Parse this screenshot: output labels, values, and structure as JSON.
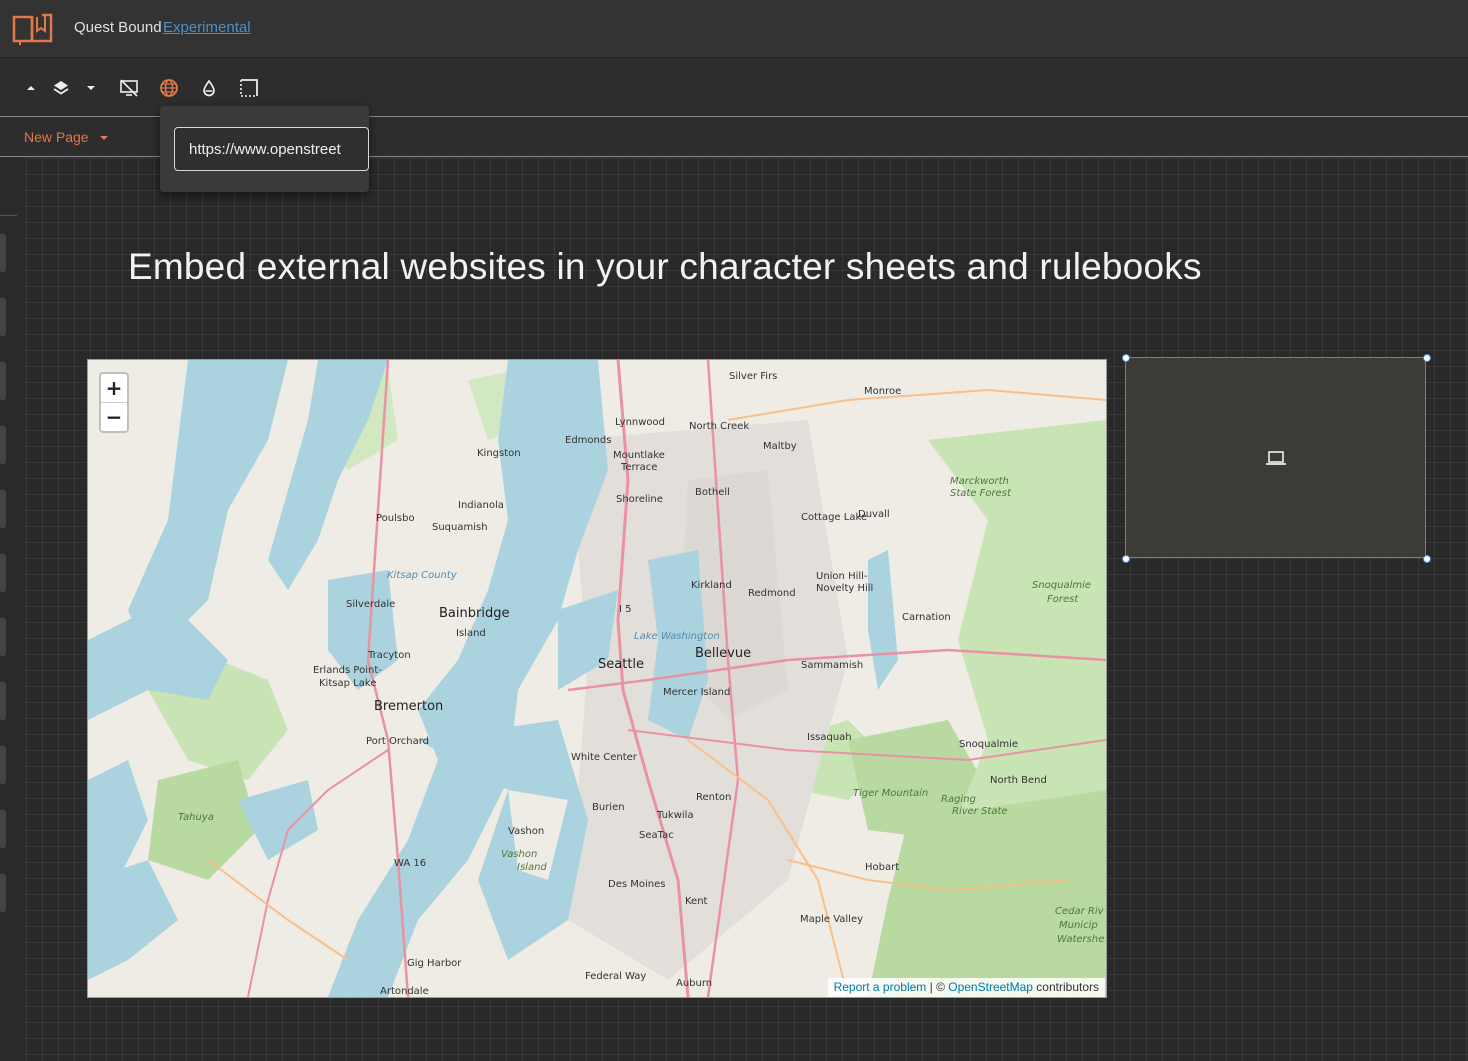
{
  "app": {
    "title": "Quest Bound",
    "tag": "Experimental",
    "brand_color": "#e0784a"
  },
  "toolbar": {
    "buttons": [
      {
        "icon": "caret-up-icon"
      },
      {
        "icon": "layers-icon"
      },
      {
        "icon": "caret-down-icon"
      },
      {
        "icon": "screen-off-icon"
      },
      {
        "icon": "globe-icon",
        "active": true
      },
      {
        "icon": "droplet-icon"
      },
      {
        "icon": "dashed-border-icon"
      }
    ]
  },
  "pages": {
    "current": "New Page"
  },
  "popover": {
    "url_value": "https://www.openstreet"
  },
  "canvas": {
    "headline": "Embed external websites in your character sheets and rulebooks"
  },
  "map": {
    "zoom_in": "+",
    "zoom_out": "−",
    "attribution": {
      "report": "Report a problem",
      "separator": " | © ",
      "osm": "OpenStreetMap",
      "contributors": " contributors"
    },
    "labels": [
      {
        "text": "Silver Firs"
      },
      {
        "text": "Monroe"
      },
      {
        "text": "Lynnwood"
      },
      {
        "text": "North Creek"
      },
      {
        "text": "Edmonds"
      },
      {
        "text": "Maltby"
      },
      {
        "text": "Kingston"
      },
      {
        "text": "Mountlake"
      },
      {
        "text": "Terrace"
      },
      {
        "text": "Marckworth"
      },
      {
        "text": "State Forest"
      },
      {
        "text": "Bothell"
      },
      {
        "text": "Shoreline"
      },
      {
        "text": "Indianola"
      },
      {
        "text": "Poulsbo"
      },
      {
        "text": "Cottage Lake"
      },
      {
        "text": "Duvall"
      },
      {
        "text": "Suquamish"
      },
      {
        "text": "Kitsap County"
      },
      {
        "text": "Union Hill-"
      },
      {
        "text": "Novelty Hill"
      },
      {
        "text": "Kirkland"
      },
      {
        "text": "Redmond"
      },
      {
        "text": "Snoqualmie"
      },
      {
        "text": "Forest"
      },
      {
        "text": "Silverdale"
      },
      {
        "text": "I 5"
      },
      {
        "text": "Bainbridge"
      },
      {
        "text": "Island"
      },
      {
        "text": "Carnation"
      },
      {
        "text": "Lake Washington"
      },
      {
        "text": "Tracyton"
      },
      {
        "text": "Seattle"
      },
      {
        "text": "Bellevue"
      },
      {
        "text": "Erlands Point-"
      },
      {
        "text": "Kitsap Lake"
      },
      {
        "text": "Sammamish"
      },
      {
        "text": "Mercer Island"
      },
      {
        "text": "Bremerton"
      },
      {
        "text": "Issaquah"
      },
      {
        "text": "Port Orchard"
      },
      {
        "text": "Snoqualmie"
      },
      {
        "text": "White Center"
      },
      {
        "text": "North Bend"
      },
      {
        "text": "Renton"
      },
      {
        "text": "Tiger Mountain"
      },
      {
        "text": "Raging"
      },
      {
        "text": "River State"
      },
      {
        "text": "Burien"
      },
      {
        "text": "Tukwila"
      },
      {
        "text": "Tahuya"
      },
      {
        "text": "Vashon"
      },
      {
        "text": "SeaTac"
      },
      {
        "text": "Vashon"
      },
      {
        "text": "Island"
      },
      {
        "text": "WA 16"
      },
      {
        "text": "Hobart"
      },
      {
        "text": "Des Moines"
      },
      {
        "text": "Kent"
      },
      {
        "text": "Cedar Riv"
      },
      {
        "text": "Municip"
      },
      {
        "text": "Watershe"
      },
      {
        "text": "Maple Valley"
      },
      {
        "text": "Gig Harbor"
      },
      {
        "text": "Federal Way"
      },
      {
        "text": "Auburn"
      },
      {
        "text": "Artondale"
      }
    ]
  },
  "embed_placeholder": {
    "icon": "laptop-icon",
    "border_color": "#4a8ad0"
  }
}
